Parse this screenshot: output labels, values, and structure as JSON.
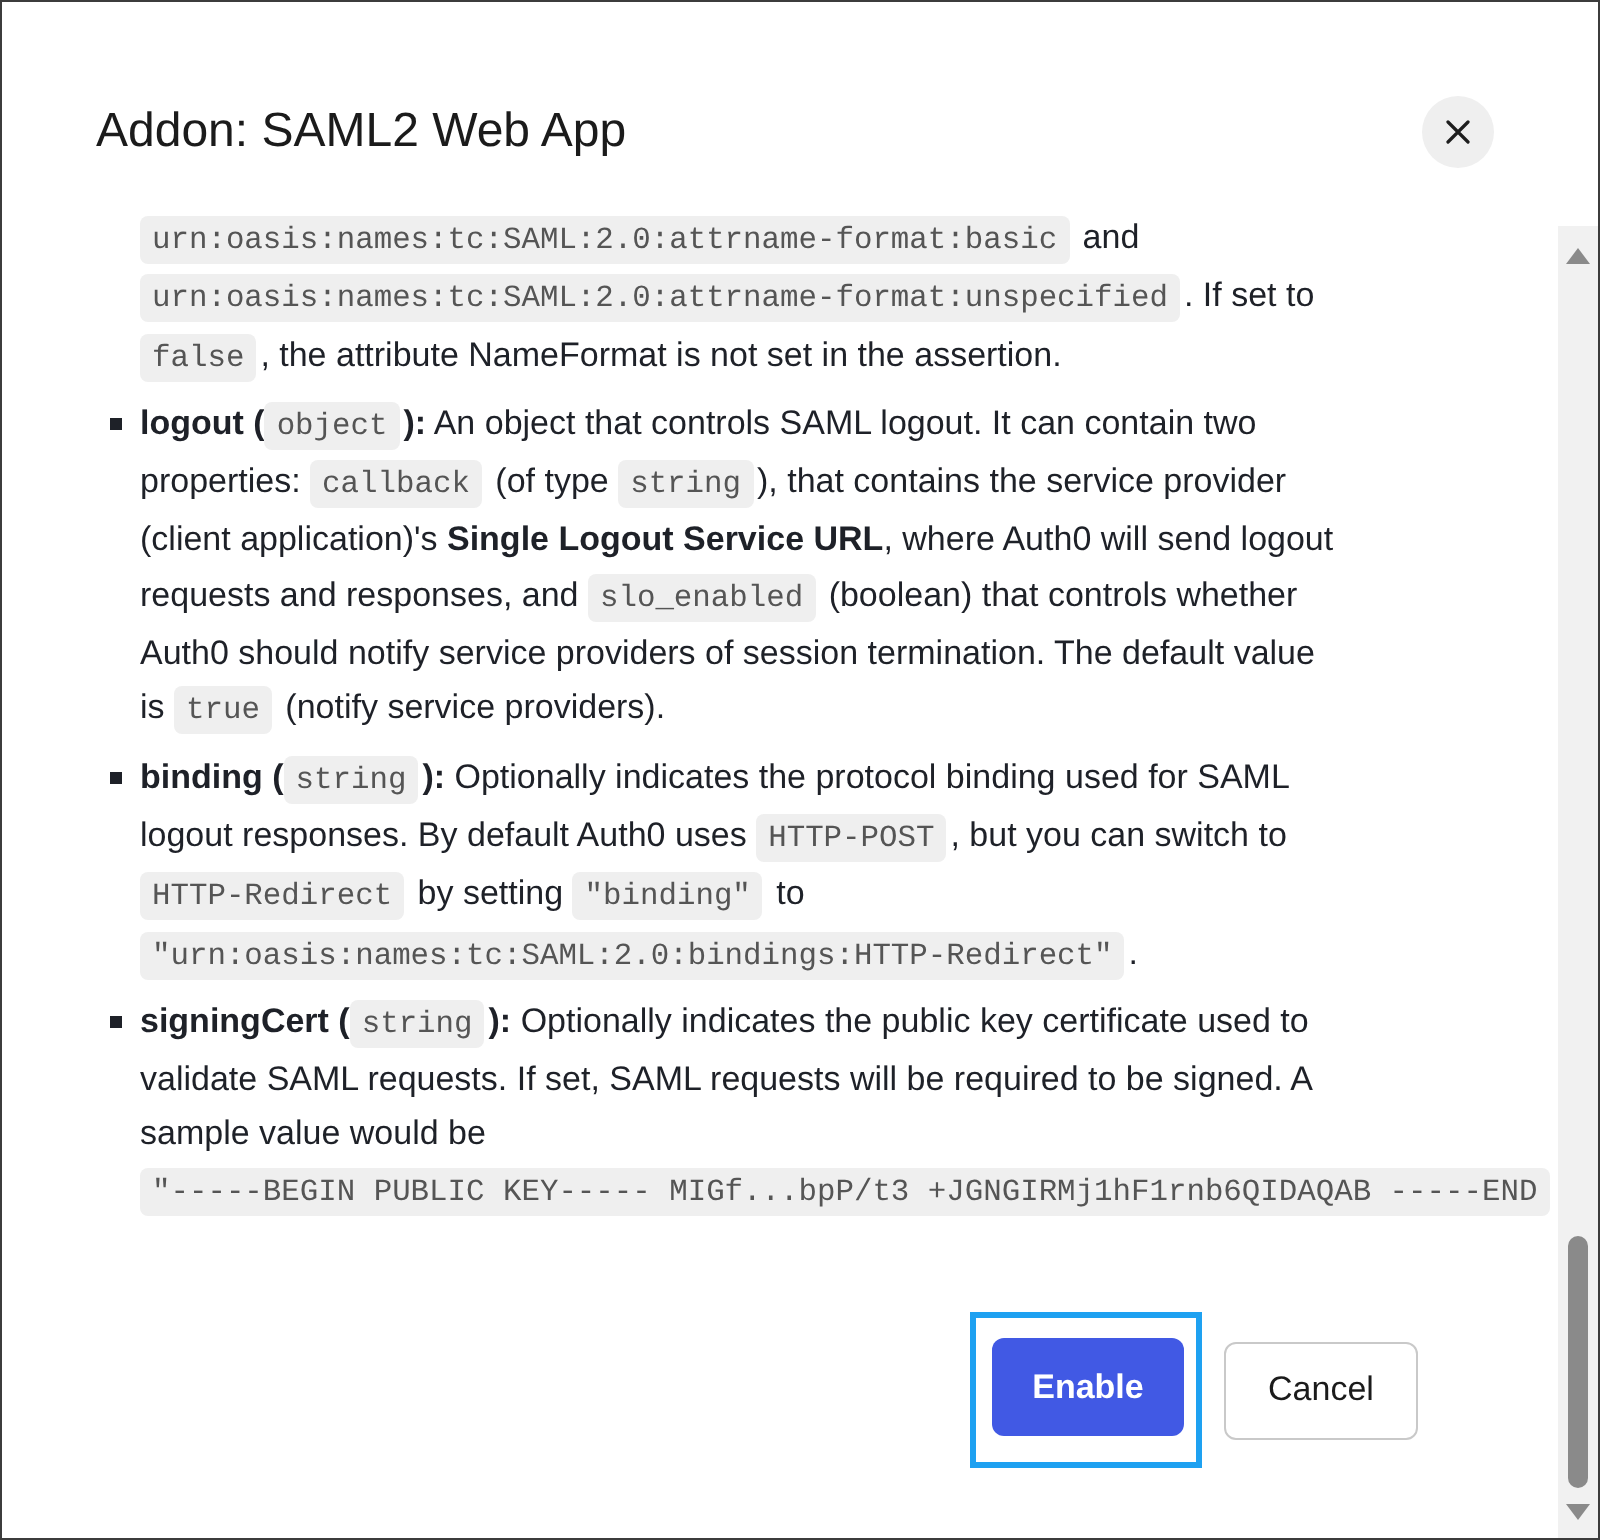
{
  "dialog": {
    "title": "Addon: SAML2 Web App"
  },
  "content": [
    {
      "kind": "continuation",
      "lines": [
        [
          {
            "kind": "code",
            "text": "urn:oasis:names:tc:SAML:2.0:attrname-format:basic"
          },
          {
            "kind": "text",
            "text": " and"
          }
        ],
        [
          {
            "kind": "code",
            "text": "urn:oasis:names:tc:SAML:2.0:attrname-format:unspecified"
          },
          {
            "kind": "text",
            "text": ". If set to"
          }
        ],
        [
          {
            "kind": "code",
            "text": "false"
          },
          {
            "kind": "text",
            "text": ", the attribute NameFormat is not set in the assertion."
          }
        ]
      ]
    },
    {
      "kind": "bullet",
      "lines": [
        [
          {
            "kind": "text",
            "text": "**logout (**"
          },
          {
            "kind": "code",
            "text": "object"
          },
          {
            "kind": "text",
            "text": "**):** An object that controls SAML logout. It can contain two"
          }
        ],
        [
          {
            "kind": "text",
            "text": "properties: "
          },
          {
            "kind": "code",
            "text": "callback"
          },
          {
            "kind": "text",
            "text": " (of type "
          },
          {
            "kind": "code",
            "text": "string"
          },
          {
            "kind": "text",
            "text": "), that contains the service provider"
          }
        ],
        [
          {
            "kind": "text",
            "text": "(client application)'s **Single Logout Service URL**, where Auth0 will send logout"
          }
        ],
        [
          {
            "kind": "text",
            "text": "requests and responses, and "
          },
          {
            "kind": "code",
            "text": "slo_enabled"
          },
          {
            "kind": "text",
            "text": " (boolean) that controls whether"
          }
        ],
        [
          {
            "kind": "text",
            "text": "Auth0 should notify service providers of session termination. The default value"
          }
        ],
        [
          {
            "kind": "text",
            "text": "is "
          },
          {
            "kind": "code",
            "text": "true"
          },
          {
            "kind": "text",
            "text": " (notify service providers)."
          }
        ]
      ]
    },
    {
      "kind": "bullet",
      "lines": [
        [
          {
            "kind": "text",
            "text": "**binding (**"
          },
          {
            "kind": "code",
            "text": "string"
          },
          {
            "kind": "text",
            "text": "**):** Optionally indicates the protocol binding used for SAML"
          }
        ],
        [
          {
            "kind": "text",
            "text": "logout responses. By default Auth0 uses "
          },
          {
            "kind": "code",
            "text": "HTTP-POST"
          },
          {
            "kind": "text",
            "text": ", but you can switch to"
          }
        ],
        [
          {
            "kind": "code",
            "text": "HTTP-Redirect"
          },
          {
            "kind": "text",
            "text": " by setting "
          },
          {
            "kind": "code",
            "text": "\"binding\""
          },
          {
            "kind": "text",
            "text": " to"
          }
        ],
        [
          {
            "kind": "code",
            "text": "\"urn:oasis:names:tc:SAML:2.0:bindings:HTTP-Redirect\""
          },
          {
            "kind": "text",
            "text": "."
          }
        ]
      ]
    },
    {
      "kind": "bullet",
      "lines": [
        [
          {
            "kind": "text",
            "text": "**signingCert (**"
          },
          {
            "kind": "code",
            "text": "string"
          },
          {
            "kind": "text",
            "text": "**):** Optionally indicates the public key certificate used to"
          }
        ],
        [
          {
            "kind": "text",
            "text": "validate SAML requests. If set, SAML requests will be required to be signed. A"
          }
        ],
        [
          {
            "kind": "text",
            "text": "sample value would be"
          }
        ],
        [
          {
            "kind": "code",
            "text": "\"-----BEGIN PUBLIC KEY----- MIGf...bpP/t3 +JGNGIRMj1hF1rnb6QIDAQAB -----END"
          }
        ]
      ]
    }
  ],
  "buttons": [
    {
      "label": "Enable",
      "kind": "primary",
      "focused": true
    },
    {
      "label": "Cancel",
      "kind": "secondary",
      "focused": false
    }
  ]
}
